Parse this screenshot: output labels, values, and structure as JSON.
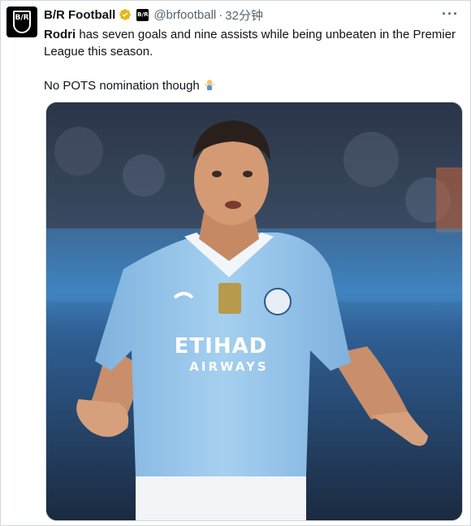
{
  "tweet": {
    "author_name": "B/R Football",
    "handle": "@brfootball",
    "separator": "·",
    "time": "32分钟",
    "avatar_text": "B/R",
    "affiliate_text": "B/R",
    "body": {
      "bold_name": "Rodri",
      "line1_rest": " has seven goals and nine assists while being unbeaten in the Premier League this season.",
      "line2": "No POTS nomination though"
    },
    "more_label": "···",
    "media": {
      "shirt_sponsor_top": "ETIHAD",
      "shirt_sponsor_bottom": "AIRWAYS"
    }
  },
  "colors": {
    "accent_text": "#0f1419",
    "secondary_text": "#536471",
    "verified_gold": "#e2b719",
    "shirt_sky_blue": "#98c5e9",
    "border": "#cfd9de"
  },
  "icons": [
    "bleacher-report-logo-icon",
    "verified-gold-badge-icon",
    "affiliate-badge-icon",
    "more-options-icon",
    "shrug-emoji-icon"
  ]
}
